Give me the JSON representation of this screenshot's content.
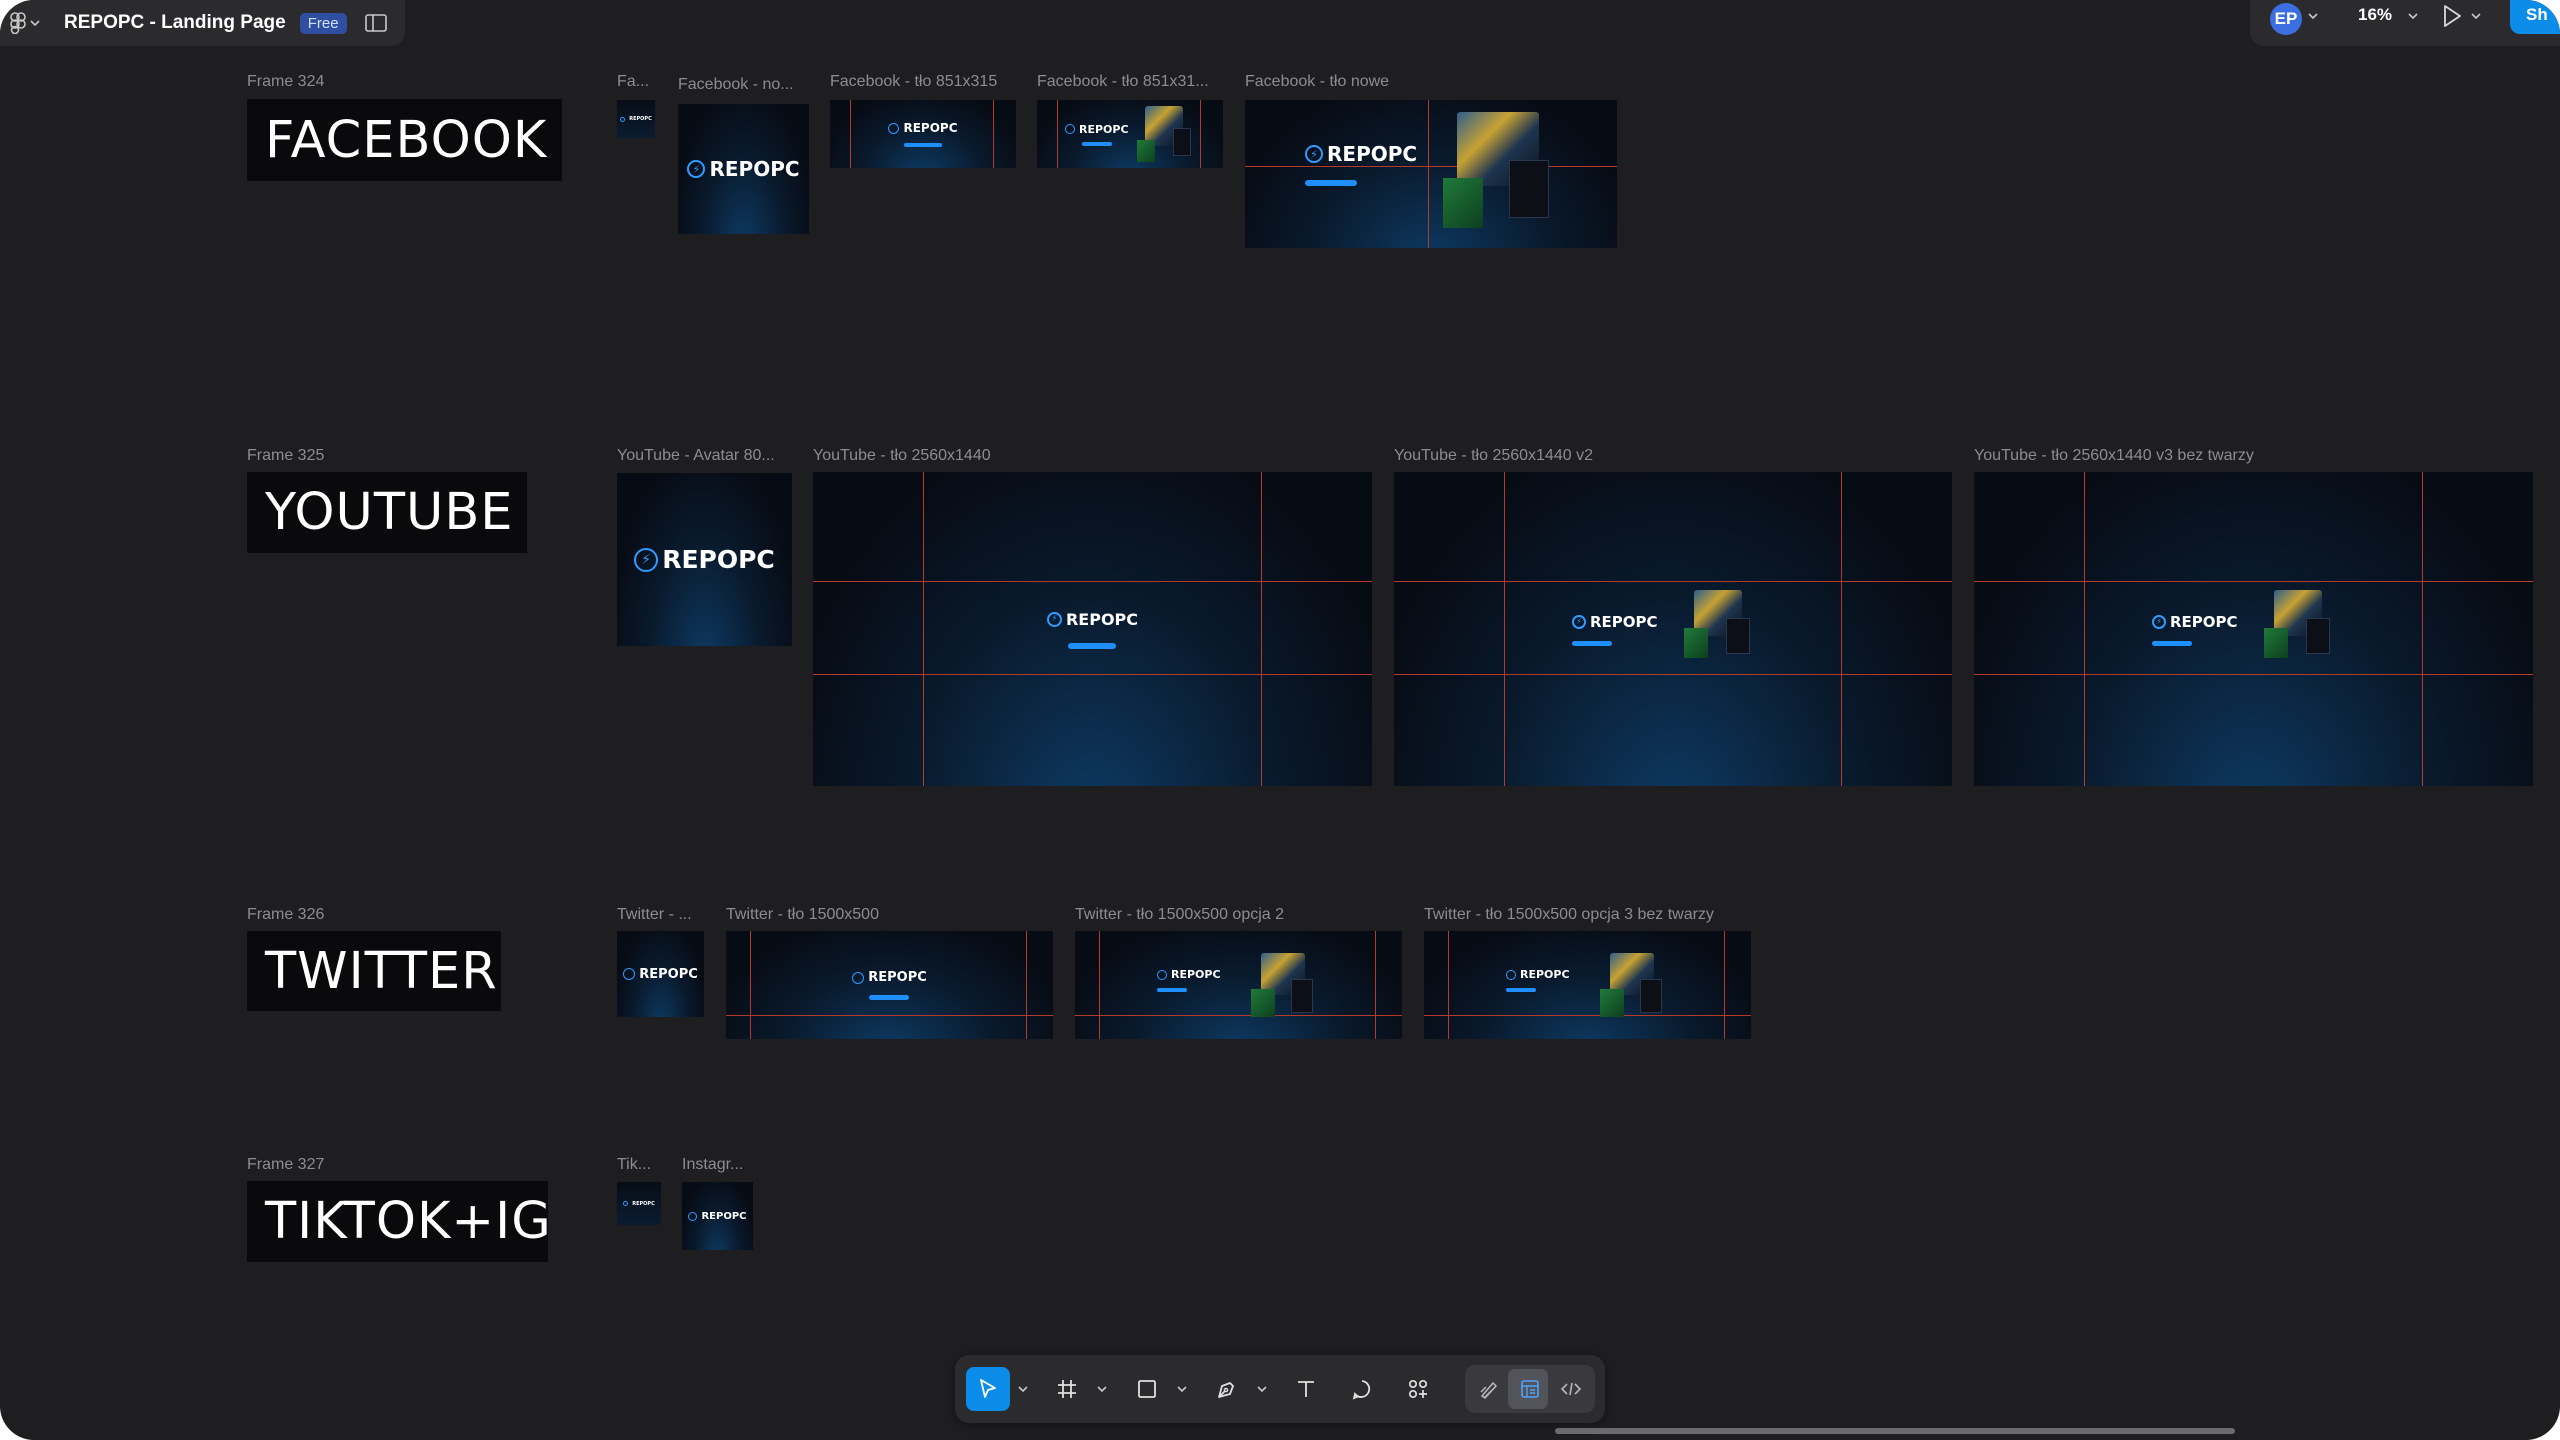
{
  "header": {
    "file_title": "REPOPC - Landing Page",
    "plan_badge": "Free",
    "avatar_initials": "EP",
    "zoom_level": "16%",
    "share_label": "Sh"
  },
  "brand": {
    "logo_text": "REPOPC",
    "accent": "#1f8fff",
    "guide_color": "#b53a2a"
  },
  "frames": {
    "facebook": {
      "label": "Frame 324",
      "title": "FACEBOOK",
      "thumbs": [
        "Fa...",
        "Facebook - no...",
        "Facebook - tło 851x315",
        "Facebook - tło 851x31...",
        "Facebook - tło nowe"
      ]
    },
    "youtube": {
      "label": "Frame 325",
      "title": "YOUTUBE",
      "thumbs": [
        "YouTube - Avatar 80...",
        "YouTube - tło 2560x1440",
        "YouTube - tło 2560x1440 v2",
        "YouTube - tło 2560x1440 v3 bez twarzy"
      ]
    },
    "twitter": {
      "label": "Frame 326",
      "title": "TWITTER",
      "thumbs": [
        "Twitter - ...",
        "Twitter - tło 1500x500",
        "Twitter - tło 1500x500 opcja 2",
        "Twitter - tło 1500x500 opcja 3 bez twarzy"
      ]
    },
    "tiktok": {
      "label": "Frame 327",
      "title": "TIKTOK+IG",
      "thumbs": [
        "Tik...",
        "Instagr..."
      ]
    }
  },
  "toolbar": {
    "tools": [
      "move-tool",
      "frame-tool",
      "shape-tool",
      "pen-tool",
      "text-tool",
      "comment-tool",
      "actions-tool",
      "draw-mode",
      "design-mode",
      "dev-mode"
    ]
  }
}
